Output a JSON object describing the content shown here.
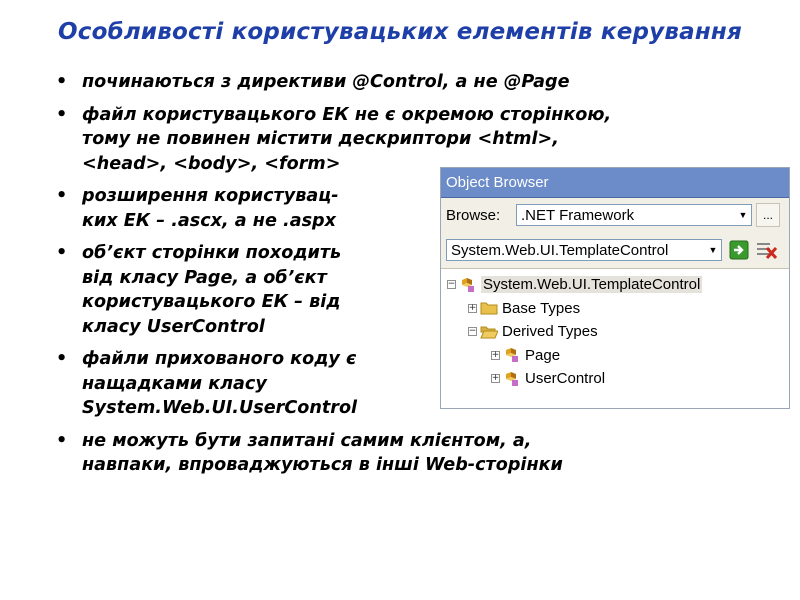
{
  "slide": {
    "title": "Особливості користувацьких елементів керування",
    "bullets": [
      {
        "lines": [
          "починаються з директиви @Control, а не @Page"
        ]
      },
      {
        "lines": [
          "файл користувацького ЕК не є окремою сторінкою,",
          "тому не повинен містити дескриптори <html>,",
          "<head>, <body>, <form>"
        ]
      },
      {
        "lines": [
          "розширення користувац­-",
          "ких ЕК – .ascx, а не .aspx"
        ]
      },
      {
        "lines": [
          "об’єкт сторінки походить",
          "від класу Page, а об’єкт",
          "користувацького ЕК – від",
          "класу UserControl"
        ]
      },
      {
        "lines": [
          "файли прихованого коду є",
          "нащадками класу",
          "System.Web.UI.UserControl"
        ]
      },
      {
        "lines": [
          "не можуть бути запитані самим клієнтом, а,",
          "навпаки, впроваджуються в інші Web-сторінки"
        ]
      }
    ]
  },
  "object_browser": {
    "title": "Object Browser",
    "browse_label": "Browse:",
    "browse_value": ".NET Framework",
    "more_label": "...",
    "path_value": "System.Web.UI.TemplateControl",
    "tree": [
      {
        "label": "System.Web.UI.TemplateControl",
        "expander": "⊟",
        "icon": "class-icon",
        "level": 0,
        "selected": true
      },
      {
        "label": "Base Types",
        "expander": "+",
        "icon": "folder-icon",
        "level": 1
      },
      {
        "label": "Derived Types",
        "expander": "−",
        "icon": "folder-open-icon",
        "level": 1
      },
      {
        "label": "Page",
        "expander": "+",
        "icon": "class-icon",
        "level": 2
      },
      {
        "label": "UserControl",
        "expander": "+",
        "icon": "class-icon",
        "level": 2
      }
    ],
    "colors": {
      "titlebar": "#6b8bc9",
      "toolbar": "#f1efe6",
      "go": "#3a9a2e",
      "delete": "#cc2a1e"
    }
  }
}
